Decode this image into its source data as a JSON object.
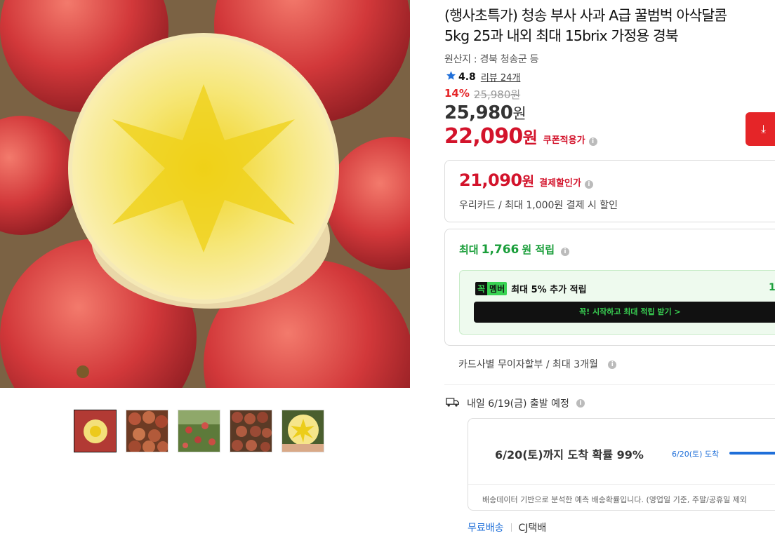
{
  "product": {
    "title_line1": "(행사초특가) 청송 부사 사과 A급 꿀범벅 아삭달콤",
    "title_line2": "5kg 25과 내외 최대 15brix 가정용 경북",
    "origin": "원산지 : 경북 청송군 등",
    "rating": "4.8",
    "review_label": "리뷰 24개",
    "discount_rate": "14%",
    "original_price": "25,980원",
    "sale_price": "25,980",
    "won": "원",
    "coupon_price": "22,090",
    "coupon_label": "쿠폰적용가"
  },
  "payment_discount": {
    "price": "21,090",
    "label": "결제할인가",
    "description": "우리카드 / 최대 1,000원 결제 시 할인"
  },
  "reward": {
    "prefix": "최대",
    "amount": "1,766",
    "suffix": "원 적립",
    "member_badge_1": "꼭",
    "member_badge_2": "멤버",
    "member_text": "최대 5% 추가 적립",
    "member_right": "1,",
    "member_button": "꼭! 시작하고 최대 적립 받기  >"
  },
  "installment": "카드사별 무이자할부 / 최대 3개월",
  "shipping": {
    "departure": "내일 6/19(금) 출발 예정",
    "arrival_probability": "6/20(토)까지 도착 확률 99%",
    "bar_label": "6/20(토) 도착",
    "note": "배송데이터 기반으로 분석한 예측 배송확률입니다. (영업일 기준, 주말/공휴일 제외",
    "free_shipping": "무료배송",
    "carrier": "CJ택배"
  },
  "colors": {
    "price_red": "#d3132b",
    "reward_green": "#1a9e3a",
    "link_blue": "#1f6fd9"
  }
}
